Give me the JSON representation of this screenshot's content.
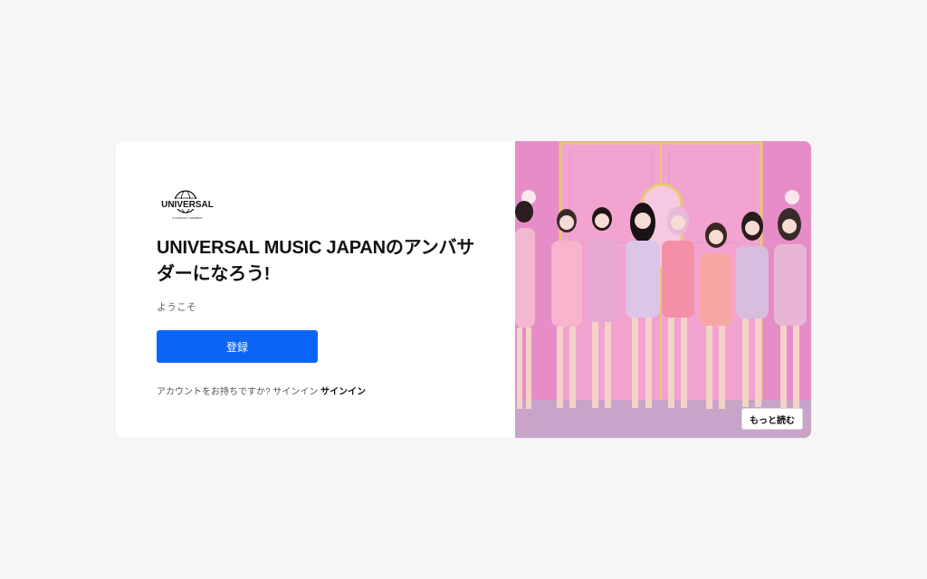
{
  "logo": {
    "wordmark": "UNIVERSAL",
    "tagline": "A COMCAST COMPANY",
    "icon": "globe-icon"
  },
  "main": {
    "title": "UNIVERSAL MUSIC JAPANのアンバサダーになろう!",
    "welcome": "ようこそ",
    "register_label": "登録",
    "signin_prompt": "アカウントをお持ちですか? サインイン",
    "signin_link": "サインイン"
  },
  "hero": {
    "more_label": "もっと読む"
  },
  "colors": {
    "accent": "#0a64f5",
    "hero_background": "#e58bc6"
  }
}
